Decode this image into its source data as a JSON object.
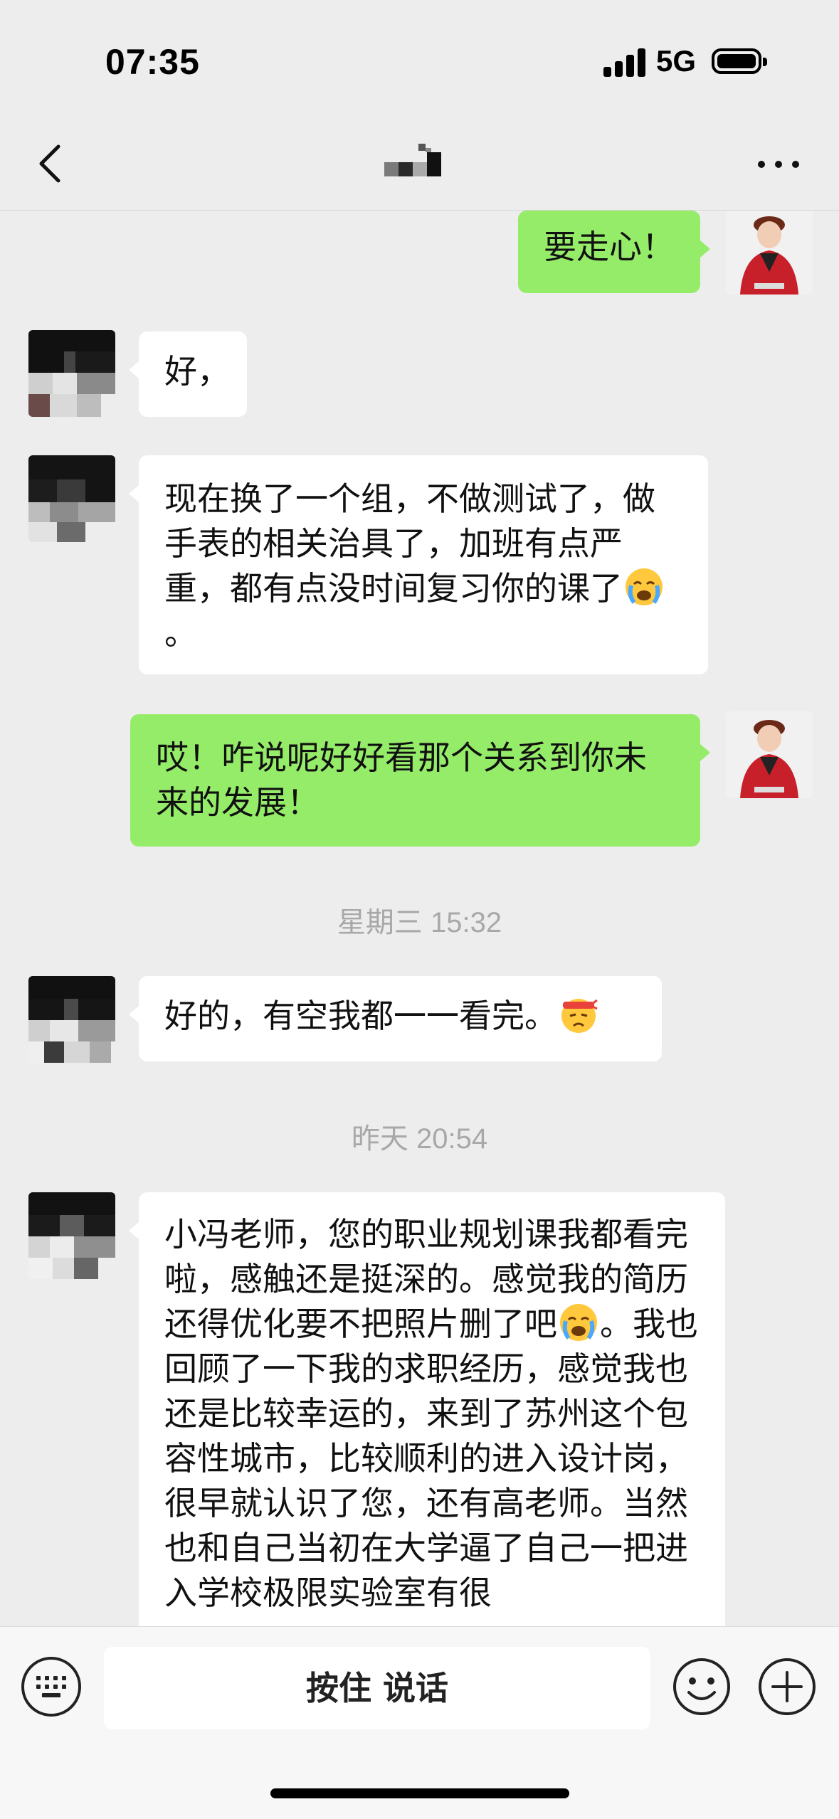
{
  "status_bar": {
    "time": "07:35",
    "network": "5G",
    "icons": [
      "signal-icon",
      "battery-icon"
    ]
  },
  "nav": {
    "back_icon": "chevron-left-icon",
    "more_icon": "more-horizontal-icon"
  },
  "messages": [
    {
      "sender": "me",
      "text": "要走心！"
    },
    {
      "sender": "contact",
      "text": "好，"
    },
    {
      "sender": "contact",
      "text_before": "现在换了一个组，不做测试了，做手表的相关治具了，加班有点严重，都有点没时间复习你的课了",
      "emoji": "crying-face",
      "text_after": "。"
    },
    {
      "sender": "me",
      "text": "哎！咋说呢好好看那个关系到你未来的发展！"
    },
    {
      "sender": "contact",
      "text_before": "好的，有空我都一一看完。",
      "emoji": "determined-face-headband"
    },
    {
      "sender": "contact",
      "text_before": "小冯老师，您的职业规划课我都看完啦，感触还是挺深的。感觉我的简历还得优化要不把照片删了吧",
      "emoji": "crying-face",
      "text_after": "。我也回顾了一下我的求职经历，感觉我也还是比较幸运的，来到了苏州这个包容性城市，比较顺利的进入设计岗，很早就认识了您，还有高老师。当然也和自己当初在大学逼了自己一把进入学校极限实验室有很"
    }
  ],
  "timestamps": [
    "星期三 15:32",
    "昨天 20:54"
  ],
  "input_bar": {
    "voice_label": "按住 说话",
    "icons": [
      "keyboard-icon",
      "emoji-icon",
      "plus-icon"
    ]
  },
  "colors": {
    "background": "#ededed",
    "outgoing_bubble": "#95ec69",
    "incoming_bubble": "#ffffff",
    "timestamp_text": "#a8a8a8"
  }
}
